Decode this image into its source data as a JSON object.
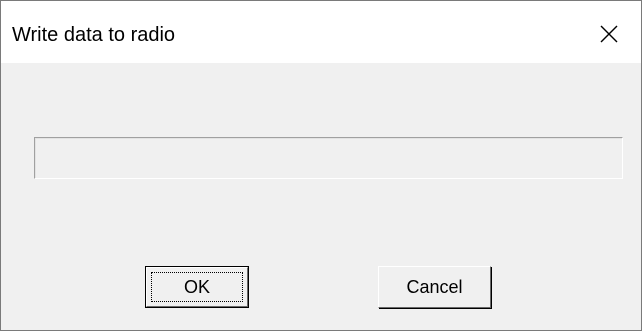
{
  "dialog": {
    "title": "Write data to radio",
    "close_icon": "close-icon"
  },
  "progress": {
    "value": 0
  },
  "buttons": {
    "ok_label": "OK",
    "cancel_label": "Cancel"
  },
  "colors": {
    "titlebar_bg": "#ffffff",
    "dialog_bg": "#f0f0f0",
    "window_border": "#7a7a7a"
  }
}
